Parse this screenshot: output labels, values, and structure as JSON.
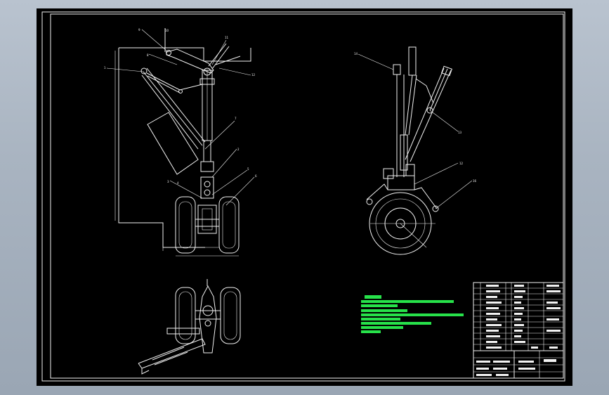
{
  "drawing": {
    "background": "#000000",
    "line_color": "#f2f2f2",
    "note_color": "#27e24a",
    "front_view_labels": [
      "9",
      "8",
      "10",
      "11",
      "1",
      "12",
      "7",
      "2",
      "3",
      "4",
      "5",
      "6"
    ],
    "side_view_labels": [
      "14",
      "13",
      "12",
      "16"
    ]
  }
}
